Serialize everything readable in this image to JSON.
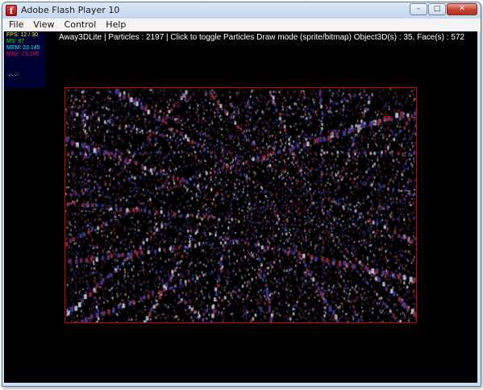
{
  "window": {
    "title": "Adobe Flash Player 10",
    "icon": "flash-player-icon",
    "controls": [
      "minimize-icon",
      "maximize-icon",
      "close-icon"
    ]
  },
  "menu": {
    "items": [
      {
        "label": "File",
        "mnemonic": "F"
      },
      {
        "label": "View",
        "mnemonic": "V"
      },
      {
        "label": "Control",
        "mnemonic": "C"
      },
      {
        "label": "Help",
        "mnemonic": "H"
      }
    ]
  },
  "stage": {
    "info_text": "Away3DLite | Particles : 2197 | Click to toggle Particles Draw mode (sprite/bitmap) Object3D(s) : 35, Face(s) : 572",
    "particle_colors": [
      "#8a2a35",
      "#3a3a9a",
      "#b8b8c8",
      "#5a2a6a"
    ],
    "bounds_color": "#cc0000",
    "background": "#000000"
  },
  "stats": {
    "fps": "FPS: 12 / 30",
    "ms": "MS: 87",
    "mem": "MEM: 23.145",
    "max": "MAX: 23.145",
    "colors": {
      "fps": "#ffff00",
      "ms": "#00ff00",
      "mem": "#00ffff",
      "max": "#ff0070"
    }
  }
}
